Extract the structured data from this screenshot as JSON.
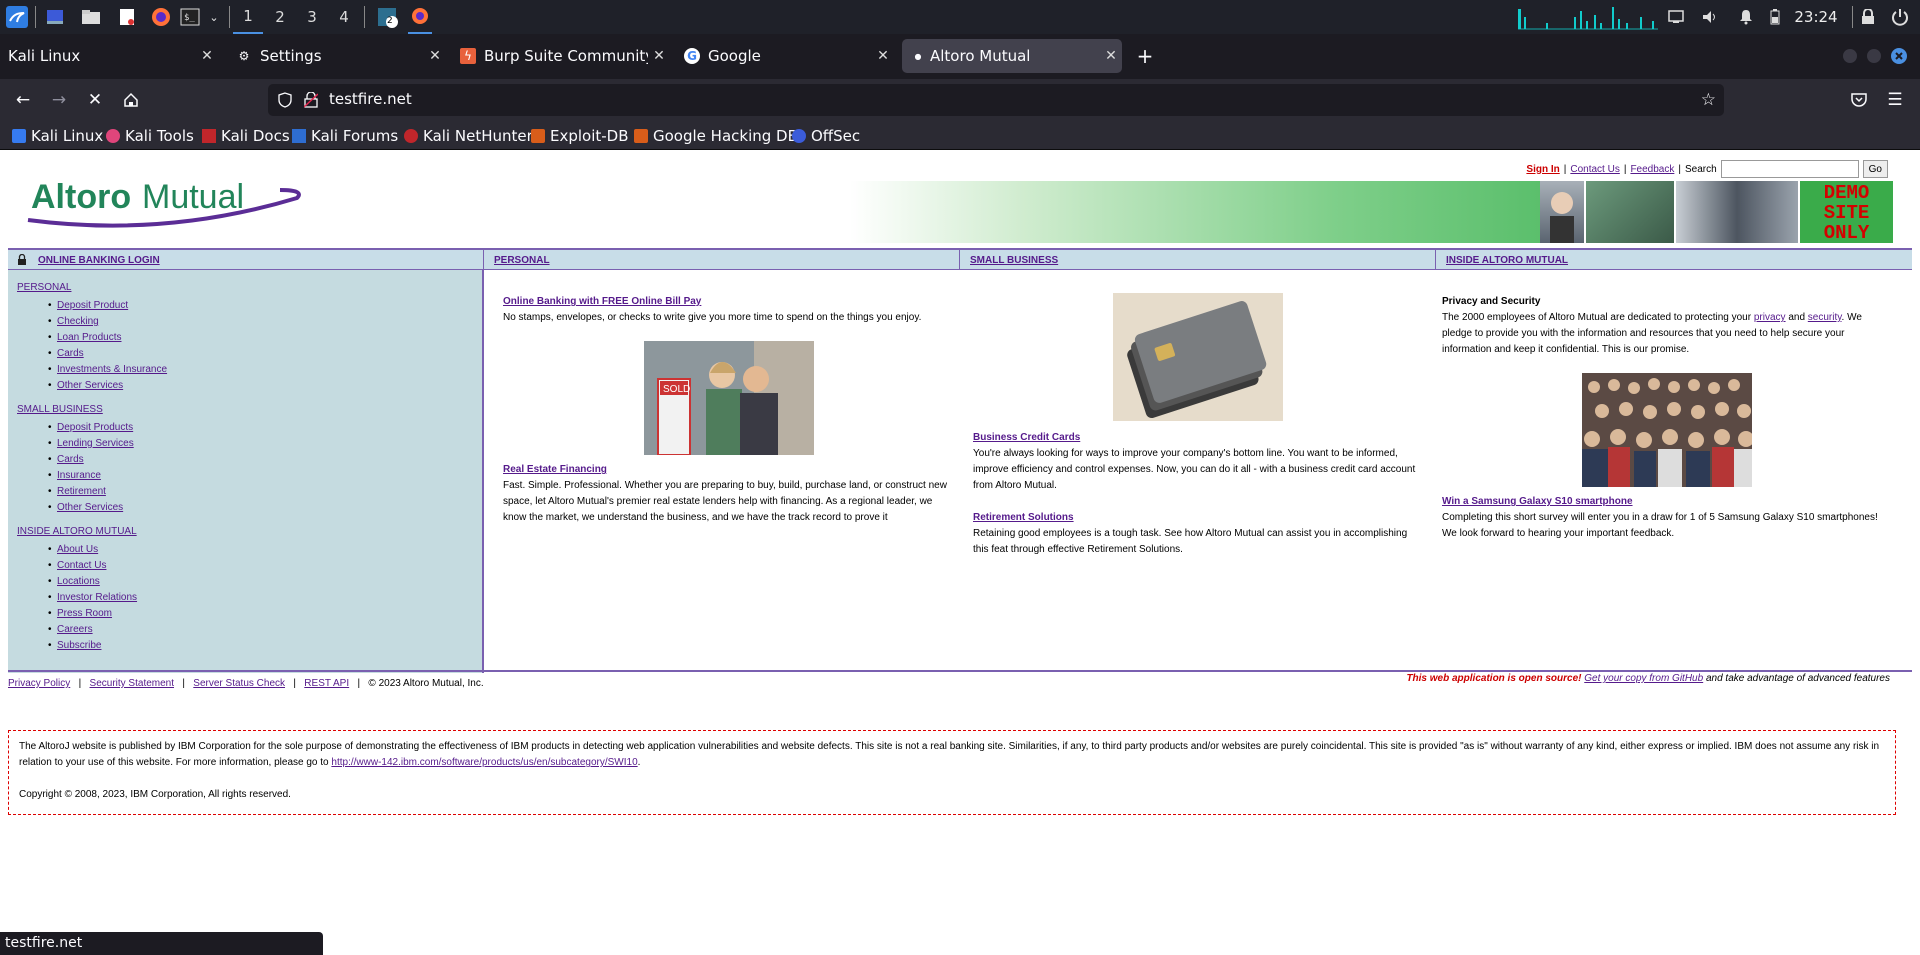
{
  "taskbar": {
    "workspaces": [
      "1",
      "2",
      "3",
      "4"
    ],
    "active_workspace": "1",
    "window_badge": "2",
    "clock": "23:24",
    "accent": "#4a90e2"
  },
  "browser": {
    "tabs": [
      {
        "label": "Kali Linux",
        "icon": "kali-icon"
      },
      {
        "label": "Settings",
        "icon": "gear-icon"
      },
      {
        "label": "Burp Suite Community Ed",
        "icon": "burp-icon"
      },
      {
        "label": "Google",
        "icon": "google-icon"
      },
      {
        "label": "Altoro Mutual",
        "icon": "loading-icon",
        "active": true
      }
    ],
    "new_tab": "+",
    "url": "testfire.net",
    "bookmarks": [
      "Kali Linux",
      "Kali Tools",
      "Kali Docs",
      "Kali Forums",
      "Kali NetHunter",
      "Exploit-DB",
      "Google Hacking DB",
      "OffSec"
    ],
    "status_text": "testfire.net"
  },
  "site": {
    "logo_text_1": "Altoro",
    "logo_text_2": "Mutual",
    "top_links": {
      "sign_in": "Sign In",
      "contact": "Contact Us",
      "feedback": "Feedback",
      "search_label": "Search",
      "search_value": "",
      "go": "Go"
    },
    "demo_badge": [
      "DEMO",
      "SITE",
      "ONLY"
    ],
    "nav": {
      "login": "ONLINE BANKING LOGIN",
      "personal": "PERSONAL",
      "small_business": "SMALL BUSINESS",
      "inside": "INSIDE ALTORO MUTUAL"
    },
    "sidebar": {
      "personal_title": "PERSONAL",
      "personal_items": [
        "Deposit Product",
        "Checking",
        "Loan Products",
        "Cards",
        "Investments & Insurance",
        "Other Services"
      ],
      "business_title": "SMALL BUSINESS",
      "business_items": [
        "Deposit Products",
        "Lending Services",
        "Cards",
        "Insurance",
        "Retirement",
        "Other Services"
      ],
      "inside_title": "INSIDE ALTORO MUTUAL",
      "inside_items": [
        "About Us",
        "Contact Us",
        "Locations",
        "Investor Relations",
        "Press Room",
        "Careers",
        "Subscribe"
      ]
    },
    "col1": {
      "t1": "Online Banking with FREE Online Bill Pay",
      "p1": "No stamps, envelopes, or checks to write give you more time to spend on the things you enjoy.",
      "t2": "Real Estate Financing",
      "p2": "Fast. Simple. Professional. Whether you are preparing to buy, build, purchase land, or construct new space, let Altoro Mutual's premier real estate lenders help with financing. As a regional leader, we know the market, we understand the business, and we have the track record to prove it"
    },
    "col2": {
      "t1": "Business Credit Cards",
      "p1": "You're always looking for ways to improve your company's bottom line. You want to be informed, improve efficiency and control expenses. Now, you can do it all - with a business credit card account from Altoro Mutual.",
      "t2": "Retirement Solutions",
      "p2": "Retaining good employees is a tough task. See how Altoro Mutual can assist you in accomplishing this feat through effective Retirement Solutions."
    },
    "col3": {
      "t1": "Privacy and Security",
      "p1a": "The 2000 employees of Altoro Mutual are dedicated to protecting your ",
      "privacy": "privacy",
      "and": " and ",
      "security": "security",
      "p1b": ". We pledge to provide you with the information and resources that you need to help secure your information and keep it confidential. This is our promise.",
      "t2": "Win a Samsung Galaxy S10 smartphone",
      "p2": "Completing this short survey will enter you in a draw for 1 of 5 Samsung Galaxy S10 smartphones! We look forward to hearing your important feedback."
    },
    "sold_sign": "SOLD",
    "footer": {
      "privacy": "Privacy Policy",
      "security": "Security Statement",
      "status": "Server Status Check",
      "rest": "REST API",
      "copyright": "© 2023 Altoro Mutual, Inc.",
      "open_source": "This web application is open source!",
      "github": "Get your copy from GitHub",
      "advanced": " and take advantage of advanced features"
    },
    "disclaimer": {
      "text": "The AltoroJ website is published by IBM Corporation for the sole purpose of demonstrating the effectiveness of IBM products in detecting web application vulnerabilities and website defects. This site is not a real banking site. Similarities, if any, to third party products and/or websites are purely coincidental. This site is provided \"as is\" without warranty of any kind, either express or implied. IBM does not assume any risk in relation to your use of this website. For more information, please go to ",
      "link": "http://www-142.ibm.com/software/products/us/en/subcategory/SWI10",
      "dot": ".",
      "copyright": "Copyright © 2008, 2023, IBM Corporation, All rights reserved."
    }
  }
}
